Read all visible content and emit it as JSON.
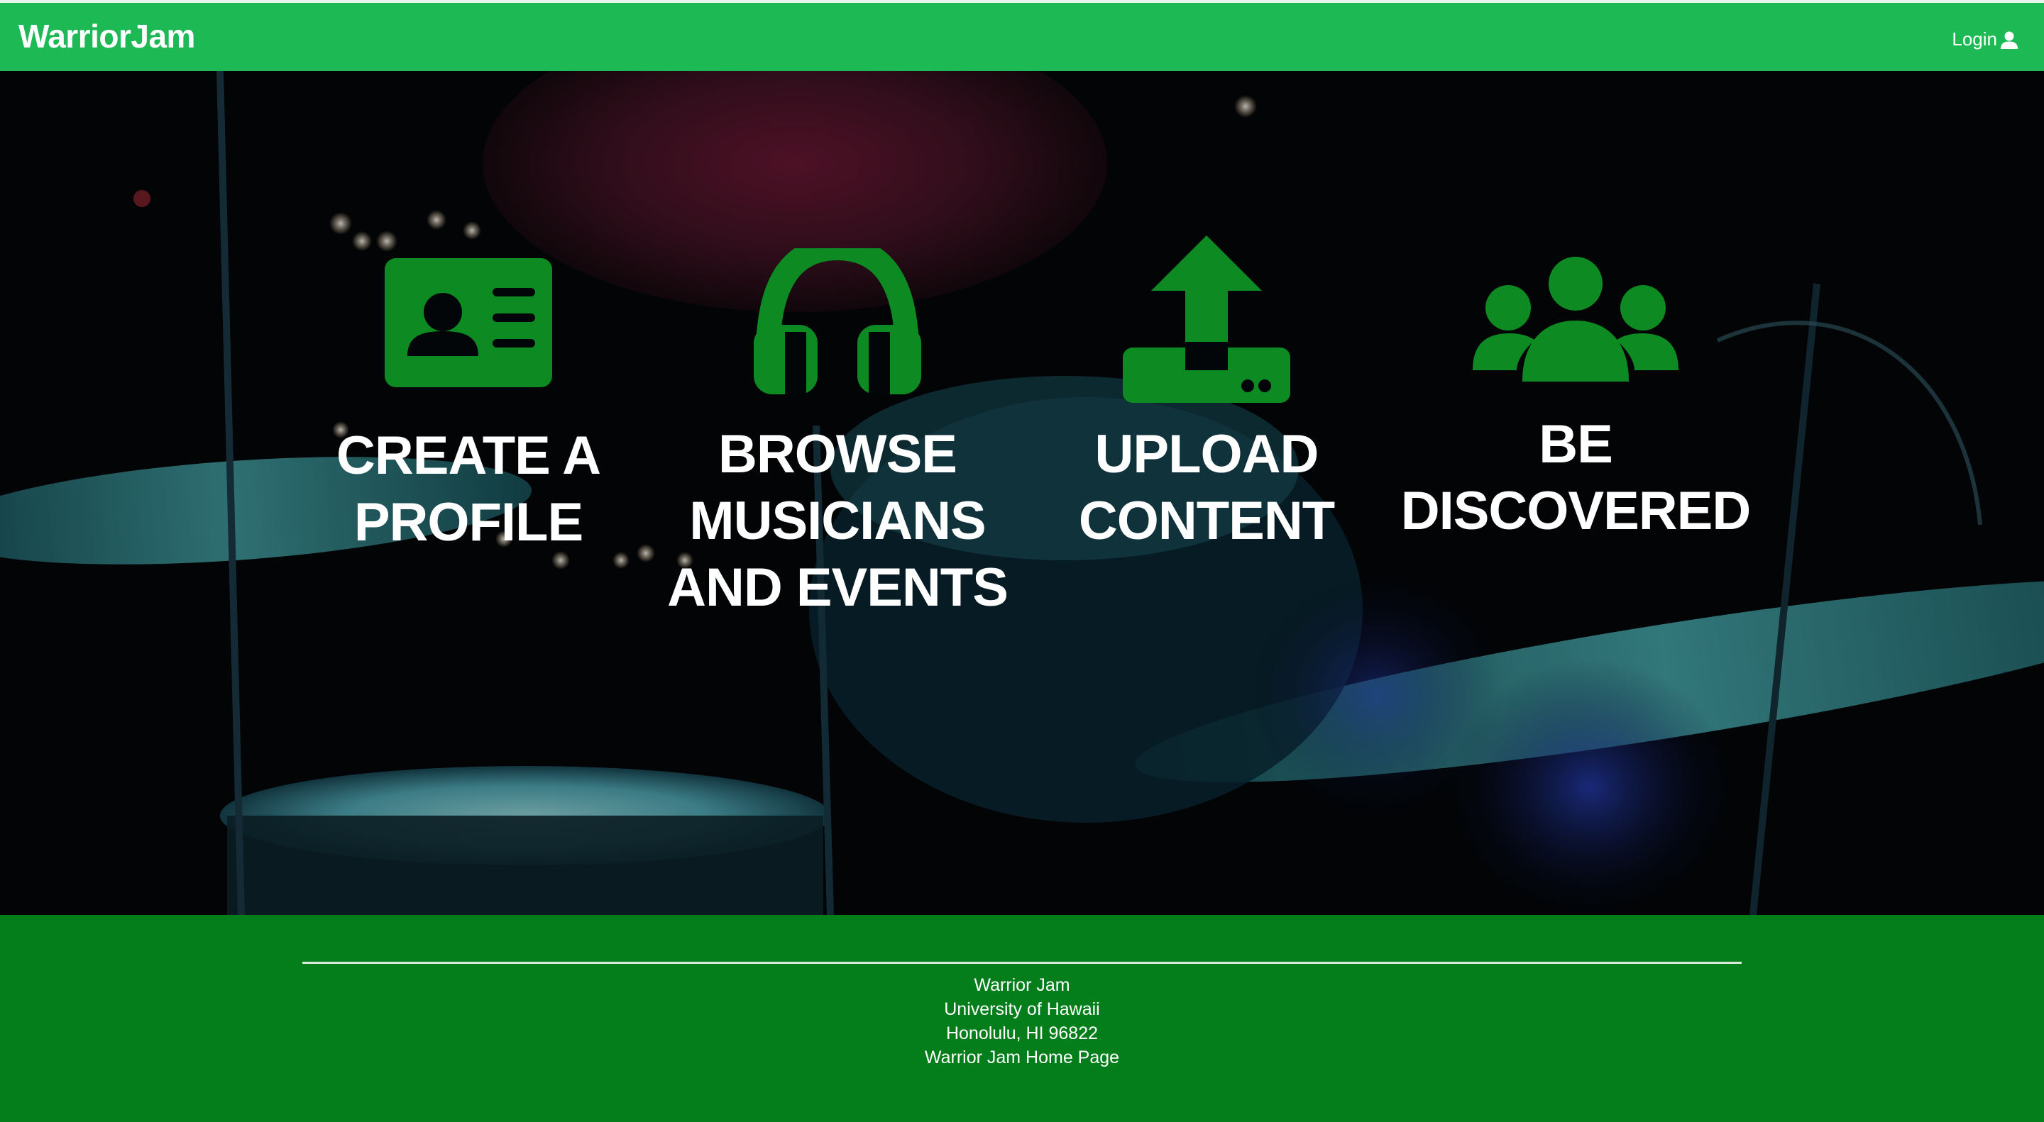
{
  "navbar": {
    "brand": "WarriorJam",
    "login_label": "Login",
    "login_icon": "user-icon",
    "background_color": "#1DB954"
  },
  "hero": {
    "background": "drum kit photo (dark, cyan/blue stage lighting)",
    "features": [
      {
        "icon": "id-card-icon",
        "label": "CREATE A PROFILE"
      },
      {
        "icon": "headphones-icon",
        "label": "BROWSE MUSICIANS AND EVENTS"
      },
      {
        "icon": "upload-icon",
        "label": "UPLOAD CONTENT"
      },
      {
        "icon": "users-icon",
        "label": "BE DISCOVERED"
      }
    ],
    "icon_color": "#0E8A22"
  },
  "footer": {
    "background_color": "#047E1B",
    "lines": [
      "Warrior Jam",
      "University of Hawaii",
      "Honolulu, HI 96822",
      "Warrior Jam Home Page"
    ]
  }
}
